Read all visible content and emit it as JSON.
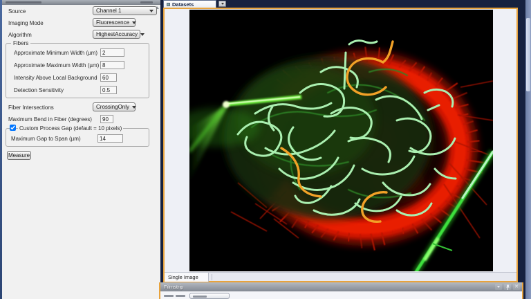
{
  "theme": {
    "window_bg": "#16213f",
    "panel_bg": "#f1f1f1",
    "accent_border": "#e8a33d",
    "canvas_bg": "#eef0f6",
    "fiber_traced": "#aaefb0",
    "fiber_flagged": "#f2a127",
    "stain_red": "#d31400",
    "stain_green": "#46e03c"
  },
  "tool_panel": {
    "source_label": "Source",
    "source_value": "Channel 1",
    "imaging_mode_label": "Imaging Mode",
    "imaging_mode_value": "Fluorescence",
    "algorithm_label": "Algorithm",
    "algorithm_value": "HighestAccuracy",
    "fibers_group_title": "Fibers",
    "min_width_label": "Approximate Minimum Width (µm)",
    "min_width_value": "2",
    "max_width_label": "Approximate Maximum Width (µm)",
    "max_width_value": "8",
    "intensity_label": "Intensity Above Local Background",
    "intensity_value": "60",
    "sensitivity_label": "Detection Sensitivity",
    "sensitivity_value": "0.5",
    "intersections_label": "Fiber Intersections",
    "intersections_value": "CrossingOnly",
    "max_bend_label": "Maximum Bend in Fiber (degrees)",
    "max_bend_value": "90",
    "custom_gap_label": "Custom Process Gap (default = 10 pixels)",
    "custom_gap_checked": true,
    "gap_span_label": "Maximum Gap to Span (µm)",
    "gap_span_value": "14",
    "measure_button": "Measure"
  },
  "document_area": {
    "tab_label": "Datasets",
    "bottom_tab_label": "Single Image"
  },
  "filmstrip": {
    "title": "Filmstrip"
  }
}
